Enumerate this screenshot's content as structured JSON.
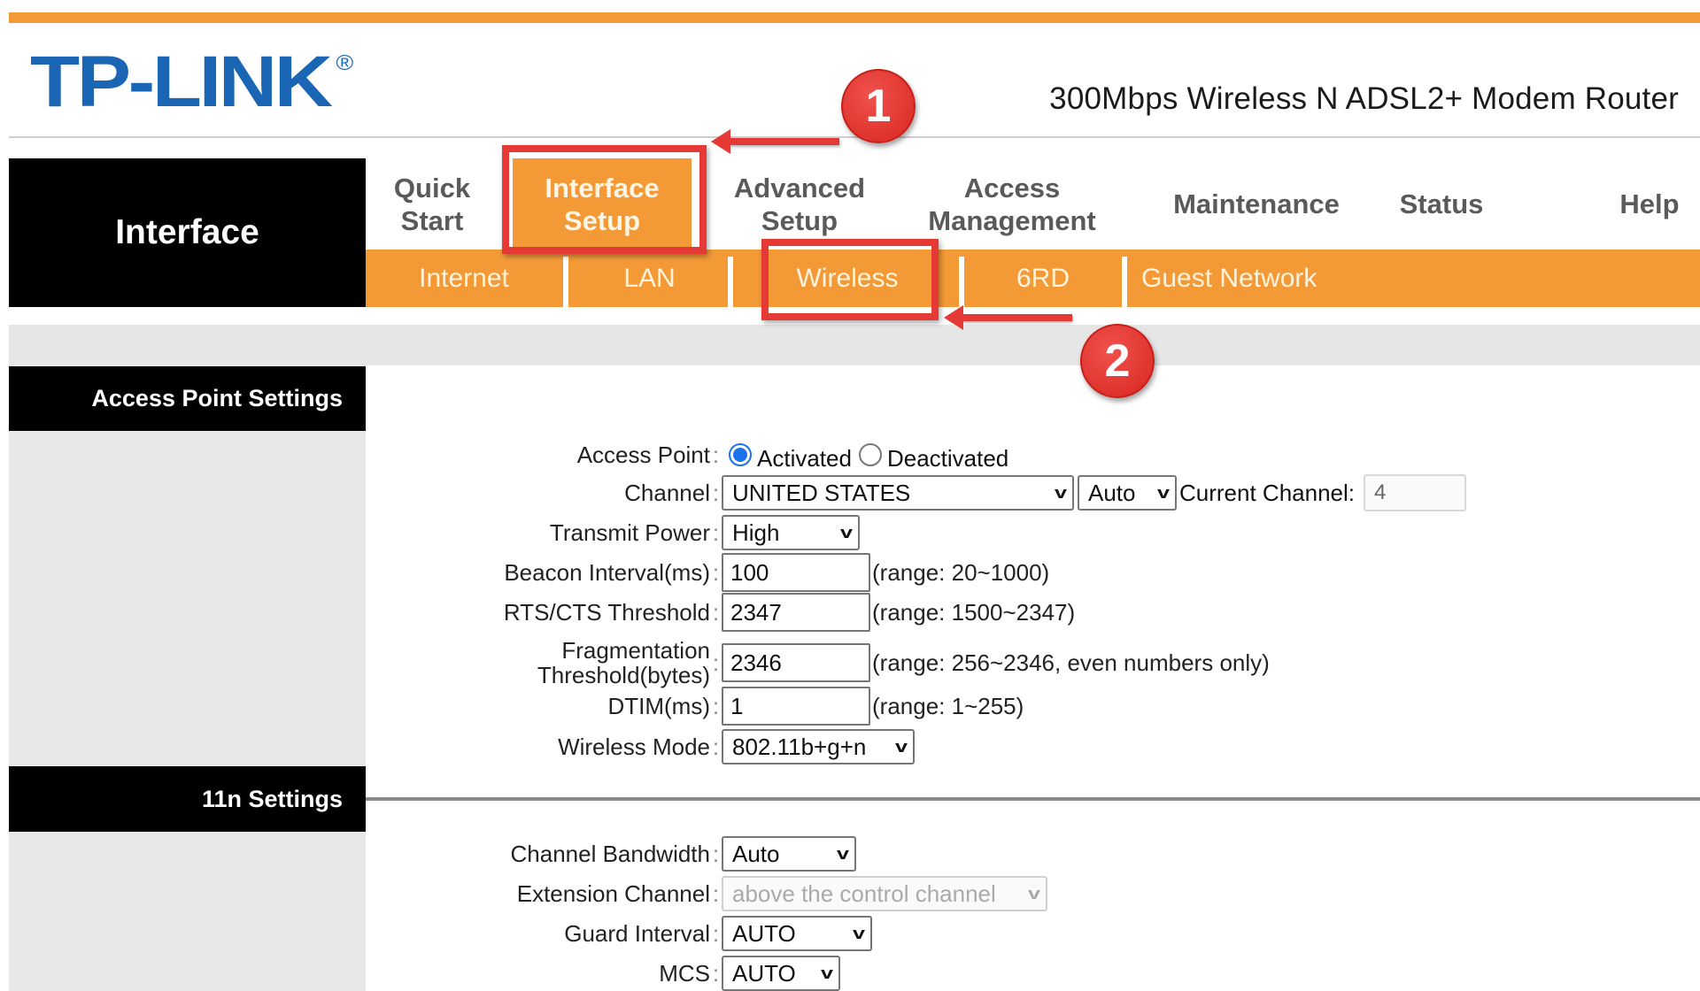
{
  "header": {
    "logo": "TP-LINK",
    "logo_mark": "®",
    "product_title": "300Mbps Wireless N ADSL2+ Modem Router",
    "accent_color": "#f39a37",
    "logo_color": "#1a66b5"
  },
  "section": {
    "title": "Interface"
  },
  "topnav": [
    {
      "label": "Quick\nStart",
      "l1": "Quick",
      "l2": "Start"
    },
    {
      "label": "Interface Setup",
      "l1": "Interface",
      "l2": "Setup",
      "active": true
    },
    {
      "label": "Advanced Setup",
      "l1": "Advanced",
      "l2": "Setup"
    },
    {
      "label": "Access Management",
      "l1": "Access",
      "l2": "Management"
    },
    {
      "label": "Maintenance"
    },
    {
      "label": "Status"
    },
    {
      "label": "Help"
    }
  ],
  "subnav": [
    {
      "label": "Internet"
    },
    {
      "label": "LAN"
    },
    {
      "label": "Wireless",
      "active": true
    },
    {
      "label": "6RD"
    },
    {
      "label": "Guest Network"
    }
  ],
  "annotations": [
    {
      "number": "1",
      "target": "Interface Setup"
    },
    {
      "number": "2",
      "target": "Wireless"
    }
  ],
  "access_point_settings": {
    "title": "Access Point Settings",
    "access_point": {
      "label": "Access Point",
      "options": [
        "Activated",
        "Deactivated"
      ],
      "selected": "Activated"
    },
    "channel": {
      "label": "Channel",
      "region": "UNITED STATES",
      "channel": "Auto",
      "current_label": "Current Channel:",
      "current_value": "4"
    },
    "transmit_power": {
      "label": "Transmit Power",
      "value": "High"
    },
    "beacon_interval": {
      "label": "Beacon Interval(ms)",
      "value": "100",
      "hint": "(range: 20~1000)"
    },
    "rts_cts": {
      "label": "RTS/CTS Threshold",
      "value": "2347",
      "hint": "(range: 1500~2347)"
    },
    "fragmentation": {
      "label_l1": "Fragmentation",
      "label_l2": "Threshold(bytes)",
      "value": "2346",
      "hint": "(range: 256~2346, even numbers only)"
    },
    "dtim": {
      "label": "DTIM(ms)",
      "value": "1",
      "hint": "(range: 1~255)"
    },
    "wireless_mode": {
      "label": "Wireless Mode",
      "value": "802.11b+g+n"
    }
  },
  "n_settings": {
    "title": "11n Settings",
    "channel_bandwidth": {
      "label": "Channel Bandwidth",
      "value": "Auto"
    },
    "extension_channel": {
      "label": "Extension Channel",
      "value": "above the control channel",
      "disabled": true
    },
    "guard_interval": {
      "label": "Guard Interval",
      "value": "AUTO"
    },
    "mcs": {
      "label": "MCS",
      "value": "AUTO"
    }
  },
  "colon": ":"
}
